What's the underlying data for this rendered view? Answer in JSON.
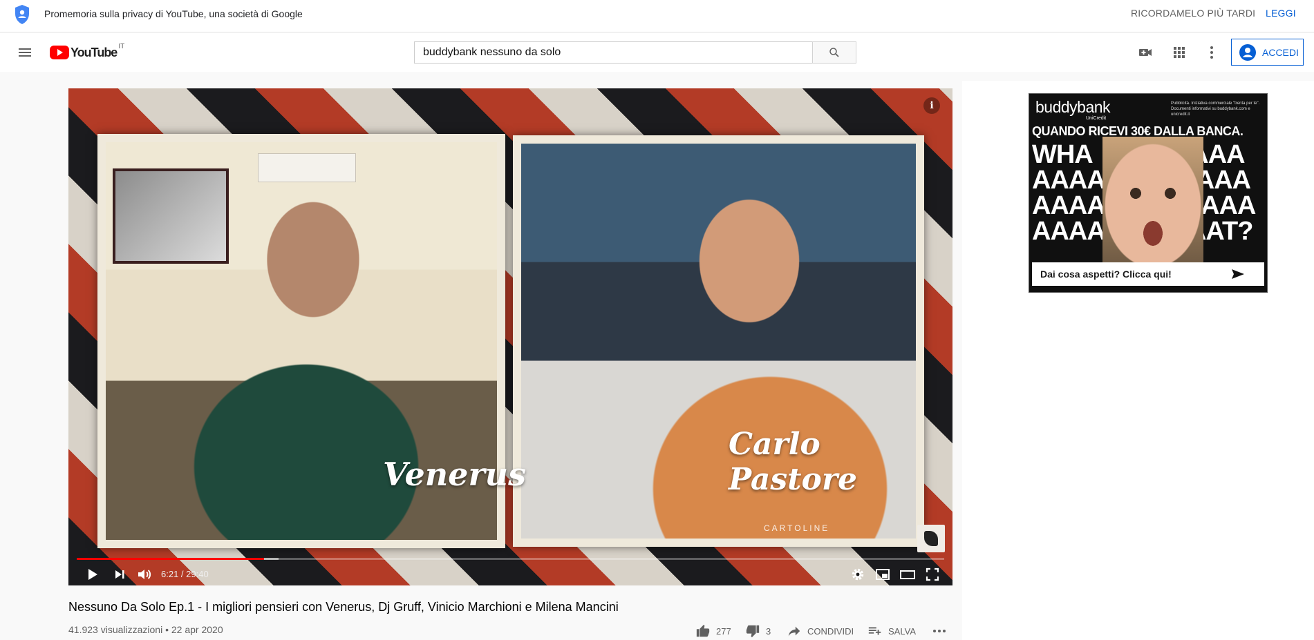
{
  "privacy_banner": {
    "text": "Promemoria sulla privacy di YouTube, una società di Google",
    "remind_later": "RICORDAMELO PIÙ TARDI",
    "read": "LEGGI"
  },
  "masthead": {
    "logo_text": "YouTube",
    "country_code": "IT",
    "search_value": "buddybank nessuno da solo",
    "signin_label": "ACCEDI"
  },
  "player": {
    "name_left": "Venerus",
    "name_right": "Carlo Pastore",
    "watermark": "CARTOLINE",
    "time": "6:21 / 29:40",
    "progress_played": 0.216,
    "progress_loaded": 0.233
  },
  "video": {
    "title": "Nessuno Da Solo Ep.1 - I migliori pensieri con Venerus, Dj Gruff, Vinicio Marchioni e Milena Mancini",
    "views_date": "41.923 visualizzazioni • 22 apr 2020",
    "likes": "277",
    "dislikes": "3",
    "share_label": "CONDIVIDI",
    "save_label": "SALVA"
  },
  "ad": {
    "brand": "buddybank",
    "brand_sub": "UniCredit",
    "disclaimer": "Pubblicità. Iniziativa commerciale \"trenta per te\". Documenti informativi su buddybank.com e unicredit.it",
    "headline": "QUANDO RICEVI 30€ DALLA BANCA.",
    "bigtext": "WHA               AAA\nAAAA              AAA\nAAAAA            AAA\nAAAAA          AAT?",
    "cta": "Dai cosa aspetti? Clicca qui!"
  },
  "colors": {
    "accent_blue": "#065fd4",
    "progress_red": "#ff0000",
    "yt_red": "#ff0000"
  },
  "icons": [
    "shield-icon",
    "menu-icon",
    "search-icon",
    "create-video-icon",
    "apps-icon",
    "more-vert-icon",
    "account-icon",
    "info-icon",
    "play-icon",
    "next-icon",
    "volume-icon",
    "settings-icon",
    "miniplayer-icon",
    "theater-icon",
    "fullscreen-icon",
    "like-icon",
    "dislike-icon",
    "share-icon",
    "save-playlist-icon",
    "more-horiz-icon",
    "arrow-right-icon"
  ]
}
